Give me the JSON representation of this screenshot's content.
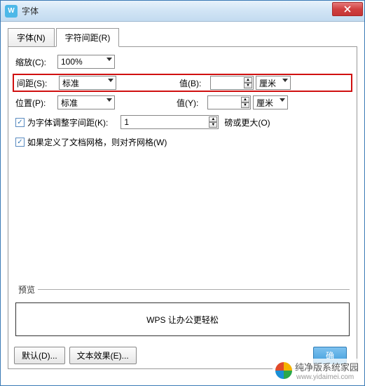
{
  "window": {
    "title": "字体",
    "icon_letter": "W"
  },
  "tabs": {
    "font": "字体(N)",
    "spacing": "字符间距(R)"
  },
  "rows": {
    "scale_label": "缩放(C):",
    "scale_value": "100%",
    "spacing_label": "间距(S):",
    "spacing_value": "标准",
    "value_r_label": "值(B):",
    "value_r_unit": "厘米",
    "position_label": "位置(P):",
    "position_value": "标准",
    "value_y_label": "值(Y):",
    "value_y_unit": "厘米",
    "kerning_label": "为字体调整字间距(K):",
    "kerning_value": "1",
    "kerning_suffix": "磅或更大(O)",
    "grid_label": "如果定义了文档网格，则对齐网格(W)"
  },
  "preview": {
    "legend": "预览",
    "text": "WPS 让办公更轻松"
  },
  "buttons": {
    "default": "默认(D)...",
    "text_effects": "文本效果(E)...",
    "ok": "确"
  },
  "watermark": {
    "text": "纯净版系统家园",
    "url": "www.yidaimei.com"
  }
}
